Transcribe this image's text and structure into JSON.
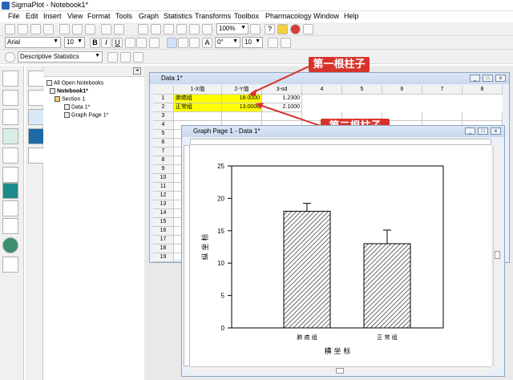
{
  "app": {
    "title": "SigmaPlot - Notebook1*"
  },
  "menu": [
    "File",
    "Edit",
    "Insert",
    "View",
    "Format",
    "Tools",
    "Graph",
    "Statistics",
    "Transforms",
    "Toolbox",
    "Pharmacology",
    "Window",
    "Help"
  ],
  "toolbar": {
    "zoom": "100%",
    "font": "Arial",
    "font_size": "10",
    "angle": "0°",
    "size2": "10",
    "stats_combo": "Descriptive Statistics"
  },
  "tree": {
    "all_open": "All Open Notebooks",
    "notebook": "Notebook1*",
    "section": "Section 1",
    "data": "Data 1*",
    "graph": "Graph Page 1*"
  },
  "data_window": {
    "title": "Data 1*",
    "columns": [
      "1-X值",
      "2-Y值",
      "3-sd",
      "4",
      "5",
      "6",
      "7",
      "8"
    ],
    "rows": [
      {
        "n": "1",
        "x": "肺癌组",
        "y": "18.0000",
        "sd": "1.2300"
      },
      {
        "n": "2",
        "x": "正常组",
        "y": "13.0000",
        "sd": "2.1000"
      }
    ],
    "row_numbers": [
      "3",
      "4",
      "5",
      "6",
      "7",
      "8",
      "9",
      "10",
      "11",
      "12",
      "13",
      "14",
      "15",
      "16",
      "17",
      "18",
      "19"
    ]
  },
  "graph_window": {
    "title": "Graph Page 1 - Data 1*"
  },
  "callouts": {
    "first": "第一根柱子",
    "second": "第二根柱子"
  },
  "colors": {
    "highlight": "#ffff00",
    "callout": "#d7332b",
    "title_bar": "#c9d9ee"
  },
  "chart_data": {
    "type": "bar",
    "categories": [
      "肺癌组",
      "正常组"
    ],
    "tick_labels": [
      "肺 癌 组",
      "正 常 组"
    ],
    "values": [
      18,
      13
    ],
    "errors": [
      1.23,
      2.1
    ],
    "xlabel": "横 坐 标",
    "ylabel": "纵 坐 标",
    "ylim": [
      0,
      25
    ],
    "yticks": [
      0,
      5,
      10,
      15,
      20,
      25
    ],
    "grid": false,
    "fill": "diagonal hatch"
  }
}
